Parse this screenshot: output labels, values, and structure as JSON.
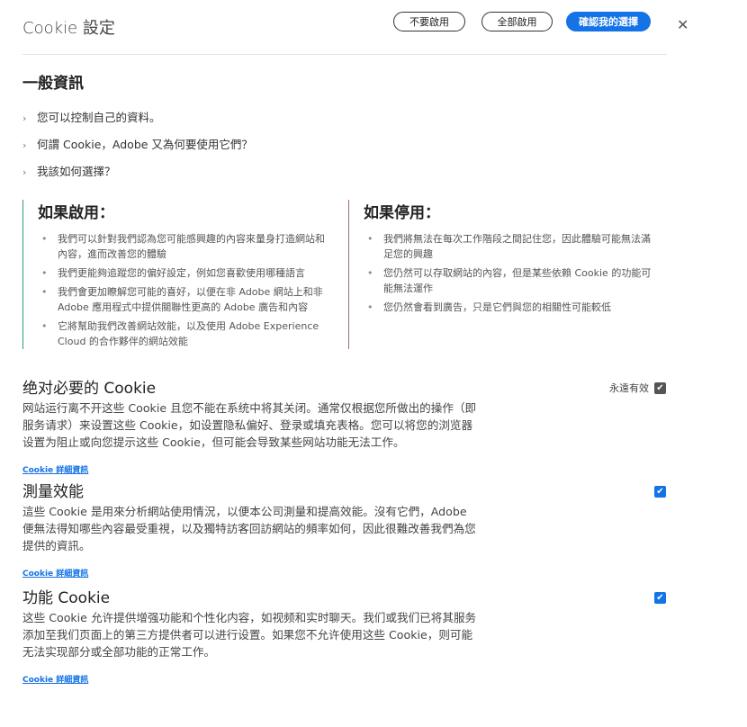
{
  "header": {
    "title": "Cookie 設定",
    "reject_all": "不要啟用",
    "accept_all": "全部啟用",
    "confirm": "確認我的選擇",
    "close": "✕"
  },
  "general": {
    "heading": "一般資訊",
    "items": [
      "您可以控制自己的資料。",
      "何謂 Cookie，Adobe 又為何要使用它們？",
      "我該如何選擇？"
    ]
  },
  "enabled": {
    "heading": "如果啟用：",
    "color": "#2d9d78",
    "items": [
      "我們可以針對我們認為您可能感興趣的內容來量身打造網站和內容，進而改善您的體驗",
      "我們更能夠追蹤您的偏好設定，例如您喜歡使用哪種語言",
      "我們會更加瞭解您可能的喜好，以便在非 Adobe 網站上和非 Adobe 應用程式中提供關聯性更高的 Adobe 廣告和內容",
      "它將幫助我們改善網站效能，以及使用 Adobe Experience Cloud 的合作夥伴的網站效能"
    ]
  },
  "disabled": {
    "heading": "如果停用：",
    "color": "#9b6b7b",
    "items": [
      "我們將無法在每次工作階段之間記住您，因此體驗可能無法滿足您的興趣",
      "您仍然可以存取網站的內容，但是某些依賴 Cookie 的功能可能無法運作",
      "您仍然會看到廣告，只是它們與您的相關性可能較低"
    ]
  },
  "sections": [
    {
      "title": "绝对必要的 Cookie",
      "status": "永遠有效",
      "checked": true,
      "text": "网站运行离不开这些 Cookie 且您不能在系统中将其关闭。通常仅根据您所做出的操作（即服务请求）来设置这些 Cookie，如设置隐私偏好、登录或填充表格。您可以将您的浏览器设置为阻止或向您提示这些 Cookie，但可能会导致某些网站功能无法工作。",
      "link": "Cookie 詳細資訊"
    },
    {
      "title": "測量效能",
      "checked": true,
      "text": "這些 Cookie 是用來分析網站使用情況，以便本公司測量和提高效能。沒有它們，Adobe 便無法得知哪些內容最受重視，以及獨特訪客回訪網站的頻率如何，因此很難改善我們為您提供的資訊。",
      "link": "Cookie 詳細資訊"
    },
    {
      "title": "功能 Cookie",
      "checked": true,
      "text": "这些 Cookie 允许提供增强功能和个性化内容，如视频和实时聊天。我们或我们已将其服务添加至我们页面上的第三方提供者可以进行设置。如果您不允许使用这些 Cookie，则可能无法实现部分或全部功能的正常工作。",
      "link": "Cookie 詳細資訊"
    }
  ]
}
